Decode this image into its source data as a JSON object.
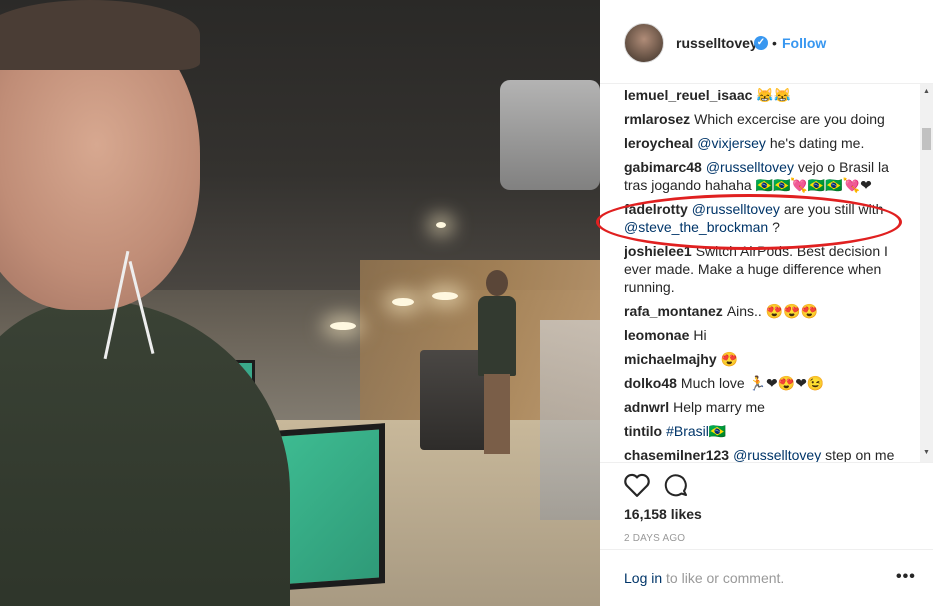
{
  "post": {
    "username": "russelltovey",
    "verified_icon": "verified-badge-icon",
    "separator": "•",
    "follow_label": "Follow"
  },
  "comments": [
    {
      "author": "lemuel_reuel_isaac",
      "text": "😹😹"
    },
    {
      "author": "rmlarosez",
      "text": "Which excercise are you doing"
    },
    {
      "author": "leroycheal",
      "mention": "@vixjersey",
      "text": " he's dating me."
    },
    {
      "author": "gabimarc48",
      "mention": "@russelltovey",
      "text": " vejo o Brasil la tras jogando hahaha 🇧🇷🇧🇷💘🇧🇷🇧🇷💘❤"
    },
    {
      "author": "fadelrotty",
      "mention": "@russelltovey",
      "text": " are you still with ",
      "mention2": "@steve_the_brockman",
      "text2": " ?"
    },
    {
      "author": "joshielee1",
      "text": "Switch AirPods. Best decision I ever made. Make a huge difference when running."
    },
    {
      "author": "rafa_montanez",
      "text": "Ains.. 😍😍😍"
    },
    {
      "author": "leomonae",
      "text": "Hi"
    },
    {
      "author": "michaelmajhy",
      "text": "😍"
    },
    {
      "author": "dolko48",
      "text": "Much love 🏃❤😍❤😉"
    },
    {
      "author": "adnwrl",
      "text": "Help marry me"
    },
    {
      "author": "tintilo",
      "mention": "#Brasil🇧🇷",
      "text": ""
    },
    {
      "author": "chasemilner123",
      "mention": "@russelltovey",
      "text": " step on me"
    }
  ],
  "actions": {
    "like_icon": "heart-icon",
    "comment_icon": "comment-bubble-icon",
    "likes": "16,158 likes",
    "date": "2 DAYS AGO"
  },
  "footer": {
    "login_link": "Log in",
    "login_rest": " to like or comment.",
    "more_label": "•••"
  },
  "colors": {
    "accent": "#3897f0",
    "link": "#003569",
    "highlight": "#e02020"
  }
}
